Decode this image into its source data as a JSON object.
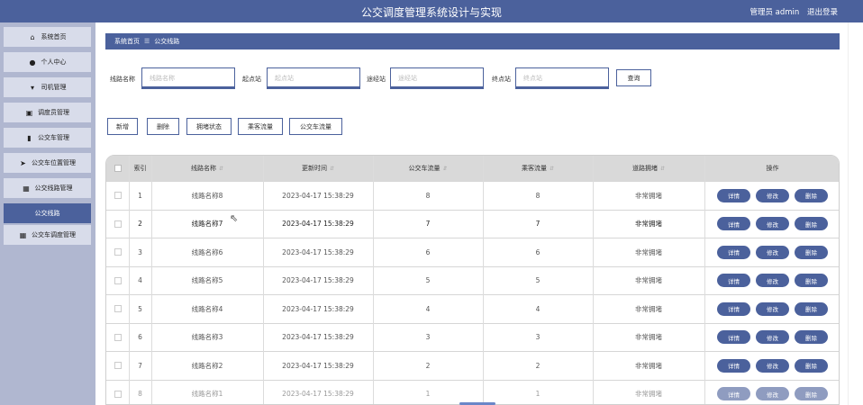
{
  "app": {
    "title": "公交调度管理系统设计与实现",
    "user_label": "管理员 admin",
    "logout": "退出登录"
  },
  "sidebar": {
    "items": [
      {
        "label": "系统首页",
        "icon": "home-icon",
        "glyph": "⌂"
      },
      {
        "label": "个人中心",
        "icon": "user-icon",
        "glyph": "●"
      },
      {
        "label": "司机管理",
        "icon": "driver-icon",
        "glyph": "▾"
      },
      {
        "label": "调度员管理",
        "icon": "dispatcher-icon",
        "glyph": "▣"
      },
      {
        "label": "公交车管理",
        "icon": "bar-chart-icon",
        "glyph": "▮"
      },
      {
        "label": "公交车位置管理",
        "icon": "location-arrow-icon",
        "glyph": "➤"
      },
      {
        "label": "公交线路管理",
        "icon": "grid-icon",
        "glyph": "▦"
      },
      {
        "label": "公交线路",
        "icon": "",
        "glyph": ""
      },
      {
        "label": "公交车调度管理",
        "icon": "grid-icon",
        "glyph": "▦"
      }
    ]
  },
  "breadcrumb": {
    "home": "系统首页",
    "separator": "☰",
    "current": "公交线路"
  },
  "search": {
    "route_name_label": "线路名称",
    "route_name_placeholder": "线路名称",
    "start_label": "起点站",
    "start_placeholder": "起点站",
    "via_label": "途经站",
    "via_placeholder": "途经站",
    "end_label": "终点站",
    "end_placeholder": "终点站",
    "query": "查询"
  },
  "actions": {
    "add": "新增",
    "delete": "删除",
    "congestion": "拥堵状态",
    "passenger_flow": "乘客流量",
    "bus_flow": "公交车流量"
  },
  "table": {
    "headers": {
      "index": "索引",
      "route_name": "线路名称",
      "updated": "更新时间",
      "bus_flow": "公交车流量",
      "passenger_flow": "乘客流量",
      "congestion": "道路拥堵",
      "ops": "操作"
    },
    "sort_glyph": "⇵",
    "ops_labels": {
      "detail": "详情",
      "edit": "修改",
      "delete": "删除"
    },
    "rows": [
      {
        "index": "1",
        "route_name": "线路名称8",
        "updated": "2023-04-17 15:38:29",
        "bus_flow": "8",
        "passenger_flow": "8",
        "congestion": "非常拥堵"
      },
      {
        "index": "2",
        "route_name": "线路名称7",
        "updated": "2023-04-17 15:38:29",
        "bus_flow": "7",
        "passenger_flow": "7",
        "congestion": "非常拥堵"
      },
      {
        "index": "3",
        "route_name": "线路名称6",
        "updated": "2023-04-17 15:38:29",
        "bus_flow": "6",
        "passenger_flow": "6",
        "congestion": "非常拥堵"
      },
      {
        "index": "4",
        "route_name": "线路名称5",
        "updated": "2023-04-17 15:38:29",
        "bus_flow": "5",
        "passenger_flow": "5",
        "congestion": "非常拥堵"
      },
      {
        "index": "5",
        "route_name": "线路名称4",
        "updated": "2023-04-17 15:38:29",
        "bus_flow": "4",
        "passenger_flow": "4",
        "congestion": "非常拥堵"
      },
      {
        "index": "6",
        "route_name": "线路名称3",
        "updated": "2023-04-17 15:38:29",
        "bus_flow": "3",
        "passenger_flow": "3",
        "congestion": "非常拥堵"
      },
      {
        "index": "7",
        "route_name": "线路名称2",
        "updated": "2023-04-17 15:38:29",
        "bus_flow": "2",
        "passenger_flow": "2",
        "congestion": "非常拥堵"
      },
      {
        "index": "8",
        "route_name": "线路名称1",
        "updated": "2023-04-17 15:38:29",
        "bus_flow": "1",
        "passenger_flow": "1",
        "congestion": "非常拥堵"
      }
    ]
  },
  "colors": {
    "primary": "#4b619c",
    "sidebar_bg": "#b0b7d0",
    "sidebar_item": "#d8dcea",
    "table_header": "#d9d9d9"
  }
}
